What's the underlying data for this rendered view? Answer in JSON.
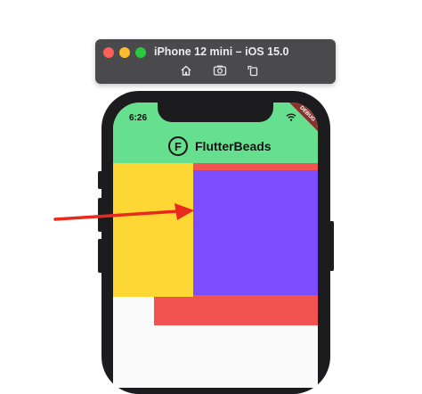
{
  "simulator": {
    "title": "iPhone 12 mini – iOS 15.0",
    "tools": [
      {
        "name": "home-icon"
      },
      {
        "name": "screenshot-icon"
      },
      {
        "name": "rotate-icon"
      }
    ]
  },
  "status_bar": {
    "time": "6:26",
    "debug_banner": "DEBUG"
  },
  "app": {
    "logo_letter": "F",
    "title": "FlutterBeads",
    "appbar_color": "#66e08e"
  },
  "boxes": [
    {
      "name": "yellow-box",
      "color": "#fdd835"
    },
    {
      "name": "red-box",
      "color": "#f25250"
    },
    {
      "name": "purple-box",
      "color": "#7c4dff"
    }
  ],
  "annotation": {
    "arrow_color": "#e8291c"
  }
}
